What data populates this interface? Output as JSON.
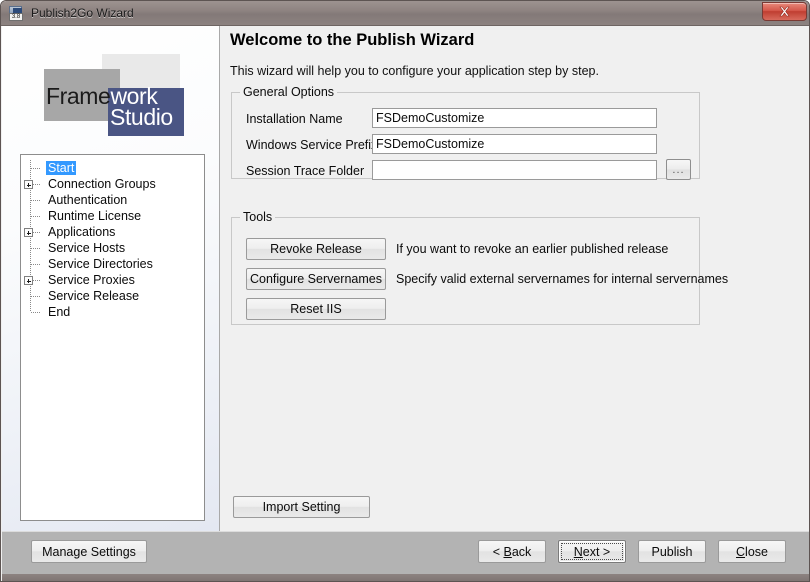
{
  "window": {
    "title": "Publish2Go Wizard",
    "icon_name": "app-icon",
    "icon_badge": "3.8",
    "close_label": "x",
    "titlebar_color": "#847b79"
  },
  "branding": {
    "logo_line1_dark": "Frame",
    "logo_line1_light": "work",
    "logo_line2": "Studio",
    "gray_color": "#a7a7a7",
    "blue_color": "#4a5584",
    "light_color": "#e9e9e9"
  },
  "tree": {
    "items": [
      {
        "label": "Start",
        "has_expander": false,
        "selected": true,
        "depth": 0
      },
      {
        "label": "Connection Groups",
        "has_expander": true,
        "selected": false,
        "depth": 0
      },
      {
        "label": "Authentication",
        "has_expander": false,
        "selected": false,
        "depth": 0
      },
      {
        "label": "Runtime License",
        "has_expander": false,
        "selected": false,
        "depth": 0
      },
      {
        "label": "Applications",
        "has_expander": true,
        "selected": false,
        "depth": 0
      },
      {
        "label": "Service Hosts",
        "has_expander": false,
        "selected": false,
        "depth": 0
      },
      {
        "label": "Service Directories",
        "has_expander": false,
        "selected": false,
        "depth": 0
      },
      {
        "label": "Service Proxies",
        "has_expander": true,
        "selected": false,
        "depth": 0
      },
      {
        "label": "Service Release",
        "has_expander": false,
        "selected": false,
        "depth": 0
      },
      {
        "label": "End",
        "has_expander": false,
        "selected": false,
        "depth": 0
      }
    ],
    "selection_color": "#3399ff"
  },
  "header": {
    "title": "Welcome to the Publish Wizard",
    "subtitle": "This wizard will help you to configure your application step by step."
  },
  "general_options": {
    "legend": "General Options",
    "fields": [
      {
        "label": "Installation Name",
        "value": "FSDemoCustomize",
        "placeholder": ""
      },
      {
        "label": "Windows Service Prefix",
        "value": "FSDemoCustomize",
        "placeholder": ""
      },
      {
        "label": "Session Trace Folder",
        "value": "",
        "placeholder": ""
      }
    ],
    "browse_button_label": "..."
  },
  "tools": {
    "legend": "Tools",
    "rows": [
      {
        "button": "Revoke Release",
        "description": "If you want to revoke an earlier published release"
      },
      {
        "button": "Configure Servernames",
        "description": "Specify valid external servernames for internal servernames"
      },
      {
        "button": "Reset IIS",
        "description": ""
      }
    ]
  },
  "actions": {
    "import_setting": "Import Setting",
    "manage_settings": "Manage Settings",
    "back": "< Back",
    "back_prefix": "< ",
    "back_accel": "B",
    "back_suffix": "ack",
    "next_prefix": "",
    "next_accel": "N",
    "next_suffix": "ext >",
    "publish": "Publish",
    "close_prefix": "",
    "close_accel": "C",
    "close_suffix": "lose"
  }
}
